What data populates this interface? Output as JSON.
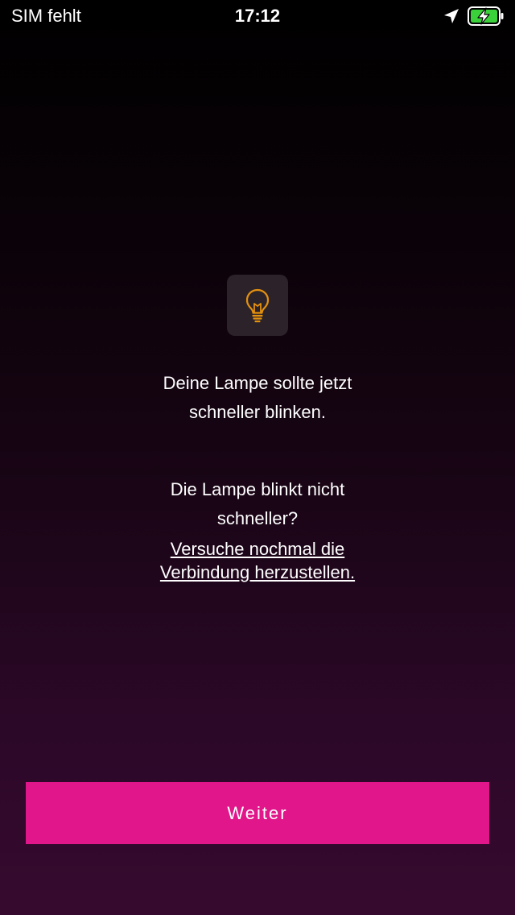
{
  "status_bar": {
    "carrier": "SIM fehlt",
    "time": "17:12",
    "icons": [
      "location-arrow-icon",
      "battery-charging-icon"
    ],
    "battery_color": "#3ad13a"
  },
  "lamp_tile": {
    "icon": "lightbulb-icon",
    "icon_color": "#e3900f"
  },
  "message": {
    "line1": "Deine Lampe sollte jetzt",
    "line2": "schneller blinken."
  },
  "help": {
    "question_line1": "Die Lampe blinkt nicht",
    "question_line2": "schneller?",
    "link_line1": "Versuche nochmal die",
    "link_line2": "Verbindung herzustellen."
  },
  "continue_button": {
    "label": "Weiter",
    "color": "#e0168a"
  }
}
